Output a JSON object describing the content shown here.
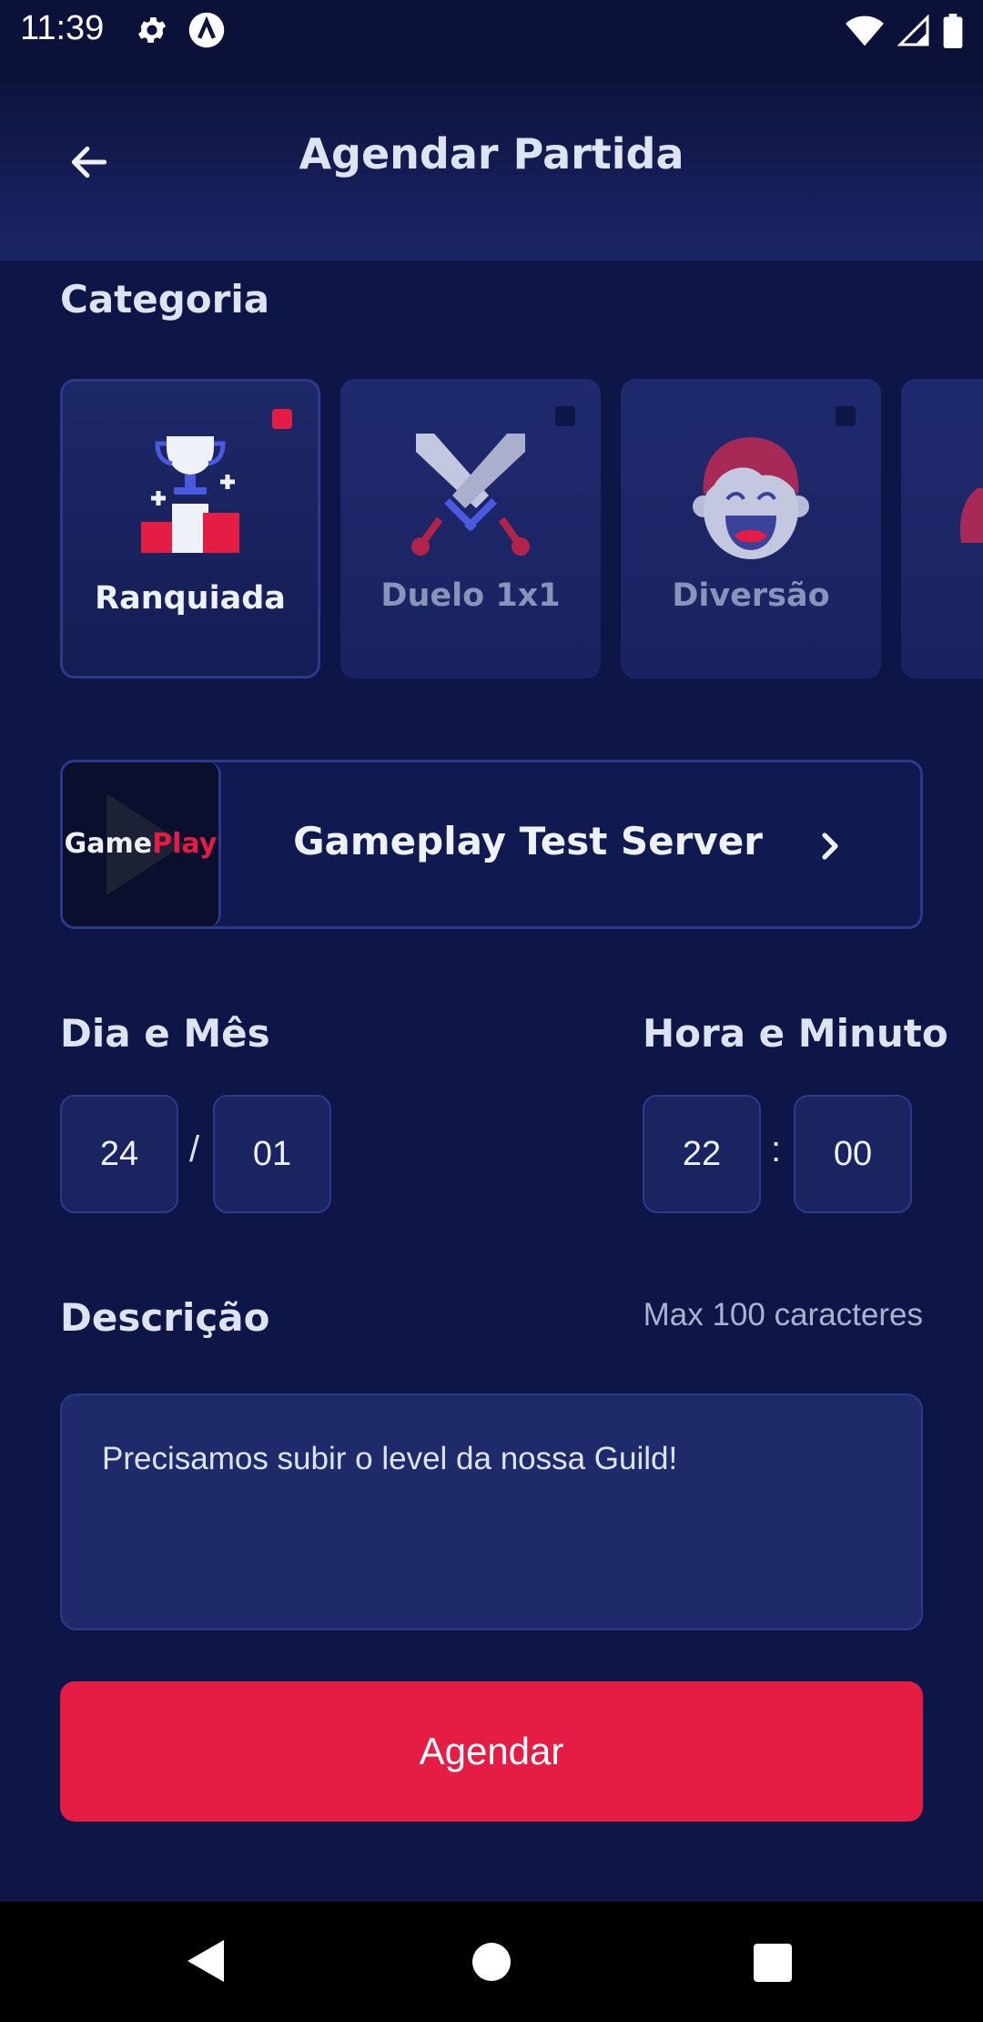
{
  "status_bar": {
    "time": "11:39",
    "icons": [
      "gear-icon",
      "a-circle-icon",
      "wifi-icon",
      "signal-icon",
      "battery-icon"
    ]
  },
  "header": {
    "title": "Agendar Partida",
    "back_icon": "arrow-left-icon"
  },
  "categories": {
    "label": "Categoria",
    "items": [
      {
        "label": "Ranquiada",
        "icon": "trophy-podium-icon",
        "selected": true
      },
      {
        "label": "Duelo 1x1",
        "icon": "crossed-swords-icon",
        "selected": false
      },
      {
        "label": "Diversão",
        "icon": "laughing-face-icon",
        "selected": false
      }
    ]
  },
  "server": {
    "name": "Gameplay Test Server",
    "logo_part1": "Game",
    "logo_part2": "Play"
  },
  "date": {
    "label": "Dia e Mês",
    "day": "24",
    "separator": "/",
    "month": "01"
  },
  "time": {
    "label": "Hora e Minuto",
    "hour": "22",
    "separator": ":",
    "minute": "00"
  },
  "description": {
    "label": "Descrição",
    "hint": "Max 100 caracteres",
    "value": "Precisamos subir o level da nossa Guild!"
  },
  "submit_label": "Agendar",
  "colors": {
    "background": "#0e1647",
    "accent": "#e51c44",
    "card": "#1f2a6e",
    "border": "#2d3a8c"
  }
}
